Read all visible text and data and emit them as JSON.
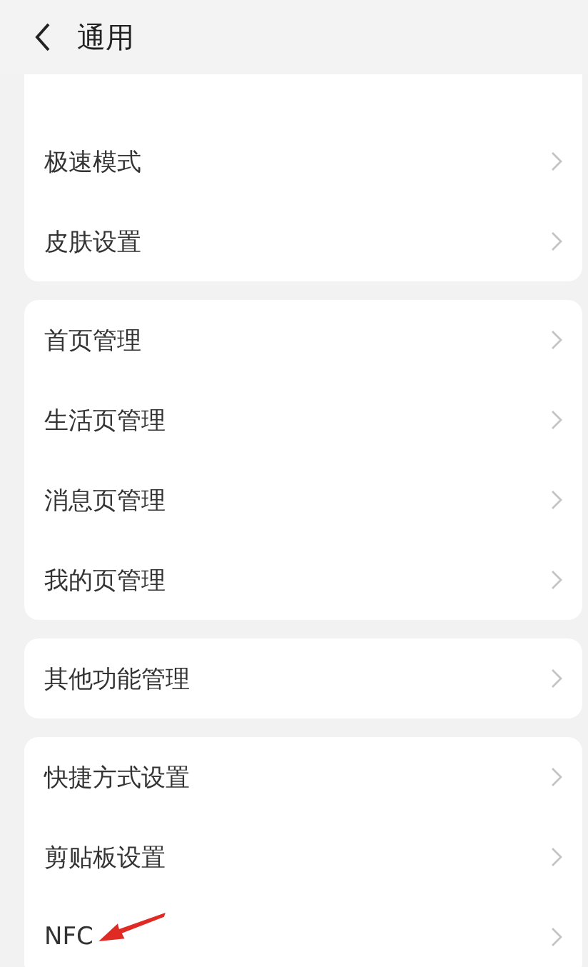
{
  "header": {
    "title": "通用"
  },
  "groups": [
    {
      "items": [
        {
          "label": "极速模式",
          "highlighted": false
        },
        {
          "label": "皮肤设置",
          "highlighted": false
        }
      ]
    },
    {
      "items": [
        {
          "label": "首页管理",
          "highlighted": false
        },
        {
          "label": "生活页管理",
          "highlighted": false
        },
        {
          "label": "消息页管理",
          "highlighted": false
        },
        {
          "label": "我的页管理",
          "highlighted": false
        }
      ]
    },
    {
      "items": [
        {
          "label": "其他功能管理",
          "highlighted": false
        }
      ]
    },
    {
      "items": [
        {
          "label": "快捷方式设置",
          "highlighted": false
        },
        {
          "label": "剪贴板设置",
          "highlighted": false
        },
        {
          "label": "NFC",
          "highlighted": true
        }
      ]
    }
  ]
}
